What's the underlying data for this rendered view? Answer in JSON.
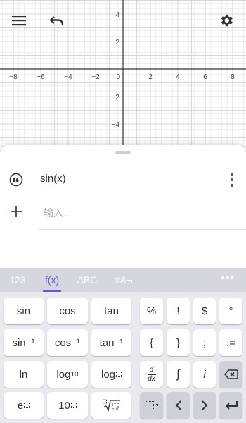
{
  "toolbar": {
    "menu_icon": "menu-icon",
    "undo_icon": "undo-icon",
    "settings_icon": "gear-icon"
  },
  "graph": {
    "x_ticks": [
      "−8",
      "−6",
      "−4",
      "−2",
      "0",
      "2",
      "4",
      "6",
      "8"
    ],
    "y_ticks_positive": [
      "4",
      "2"
    ],
    "y_ticks_negative": [
      "−2",
      "−4"
    ],
    "grid": true
  },
  "algebra": {
    "expression": "sin(x)",
    "input_placeholder": "输入..."
  },
  "keyboard": {
    "tabs": [
      "123",
      "f(x)",
      "ABC",
      "#&¬"
    ],
    "active_tab": "f(x)",
    "more_label": "•••",
    "rows": [
      [
        "sin",
        "cos",
        "tan",
        "%",
        "!",
        "$",
        "°"
      ],
      [
        "sin⁻¹",
        "cos⁻¹",
        "tan⁻¹",
        "{",
        "}",
        ";",
        ":="
      ],
      [
        "ln",
        "log10",
        "log",
        "d/dx",
        "∫",
        "i",
        "backspace"
      ],
      [
        "e^",
        "10^",
        "nroot",
        "square",
        "<",
        ">",
        "enter"
      ]
    ],
    "labels": {
      "sin": "sin",
      "cos": "cos",
      "tan": "tan",
      "percent": "%",
      "factorial": "!",
      "dollar": "$",
      "degree": "°",
      "asin": "sin⁻¹",
      "acos": "cos⁻¹",
      "atan": "tan⁻¹",
      "lbrace": "{",
      "rbrace": "}",
      "semicolon": ";",
      "assign": ":=",
      "ln": "ln",
      "log10_base": "log",
      "log10_sub": "10",
      "logb": "log",
      "deriv_top": "d",
      "deriv_bottom": "dx",
      "integral": "∫",
      "imag": "i",
      "e": "e",
      "ten": "10"
    },
    "accent_color": "#6557d2"
  }
}
